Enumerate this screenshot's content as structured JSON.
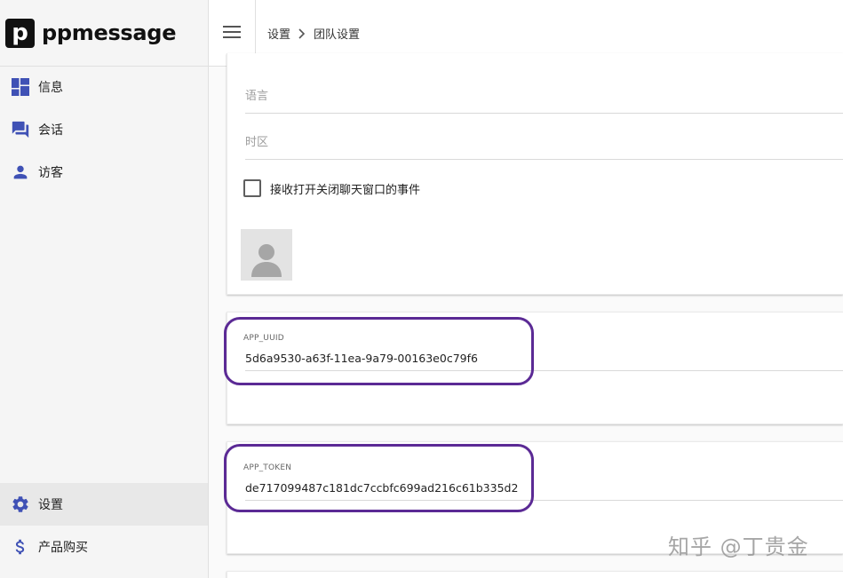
{
  "app": {
    "logo_letter": "p",
    "name": "ppmessage"
  },
  "sidebar": {
    "items": [
      {
        "label": "信息",
        "icon": "dashboard-icon"
      },
      {
        "label": "会话",
        "icon": "forum-icon"
      },
      {
        "label": "访客",
        "icon": "person-icon"
      }
    ],
    "bottom_items": [
      {
        "label": "设置",
        "icon": "gear-icon",
        "active": true
      },
      {
        "label": "产品购买",
        "icon": "dollar-icon"
      }
    ]
  },
  "header": {
    "breadcrumb": [
      "设置",
      "团队设置"
    ]
  },
  "form": {
    "language_placeholder": "语言",
    "timezone_placeholder": "时区",
    "checkbox_label": "接收打开关闭聊天窗口的事件",
    "checkbox_checked": false
  },
  "app_uuid": {
    "label": "APP_UUID",
    "value": "5d6a9530-a63f-11ea-9a79-00163e0c79f6"
  },
  "app_token": {
    "label": "APP_TOKEN",
    "value": "de717099487c181dc7ccbfc699ad216c61b335d2"
  },
  "watermark": "知乎 @丁贵金",
  "colors": {
    "accent": "#3f51b5",
    "highlight": "#5b2a95",
    "sidebar_bg": "#f5f5f5"
  }
}
